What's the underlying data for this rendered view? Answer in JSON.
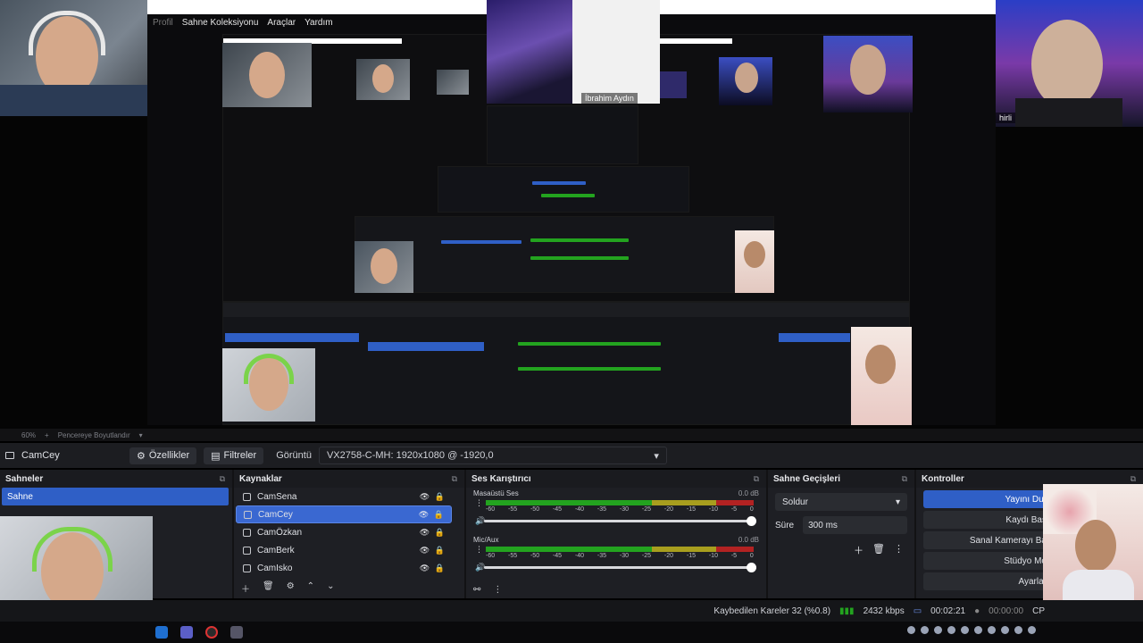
{
  "preview": {
    "menu": {
      "profile": "Profil",
      "scene_collection": "Sahne Koleksiyonu",
      "tools": "Araçlar",
      "help": "Yardım"
    },
    "cam_overlay_label": "İbrahim Aydın",
    "cam_topright_label": "hirli",
    "inner_zoom": "60%",
    "inner_fit": "Pencereye Boyutlandır"
  },
  "zoom_bar": {
    "zoom": "60%",
    "plus": "+",
    "fit_label": "Pencereye Boyutlandır"
  },
  "source_bar": {
    "current_source": "CamCey",
    "properties_label": "Özellikler",
    "filters_label": "Filtreler",
    "display_label": "Görüntü",
    "display_value": "VX2758-C-MH: 1920x1080 @ -1920,0"
  },
  "scenes": {
    "title": "Sahneler",
    "items": [
      {
        "label": "Sahne",
        "selected": true
      }
    ]
  },
  "sources": {
    "title": "Kaynaklar",
    "items": [
      {
        "label": "CamSena",
        "selected": false
      },
      {
        "label": "CamCey",
        "selected": true
      },
      {
        "label": "CamÖzkan",
        "selected": false
      },
      {
        "label": "CamBerk",
        "selected": false
      },
      {
        "label": "CamIsko",
        "selected": false
      }
    ]
  },
  "mixer": {
    "title": "Ses Karıştırıcı",
    "tracks": [
      {
        "name": "Masaüstü Ses",
        "db": "0.0 dB",
        "level": 0.6
      },
      {
        "name": "Mic/Aux",
        "db": "0.0 dB",
        "level": 0.45
      }
    ],
    "scale": [
      "-60",
      "-55",
      "-50",
      "-45",
      "-40",
      "-35",
      "-30",
      "-25",
      "-20",
      "-15",
      "-10",
      "-5",
      "0"
    ]
  },
  "transitions": {
    "title": "Sahne Geçişleri",
    "selected": "Soldur",
    "duration_label": "Süre",
    "duration_value": "300 ms"
  },
  "controls": {
    "title": "Kontroller",
    "buttons": [
      "Yayını Dur",
      "Kaydı Baş",
      "Sanal Kamerayı Ba",
      "Stüdyo Mo",
      "Ayarlar"
    ]
  },
  "status": {
    "dropped": "Kaybedilen Kareler 32 (%0.8)",
    "bitrate": "2432 kbps",
    "stream_time": "00:02:21",
    "rec_time": "00:00:00",
    "cpu": "CP"
  },
  "colors": {
    "accent": "#2f5fc6",
    "meter_green": "#23a31f",
    "meter_yellow": "#a89e1e",
    "meter_red": "#b22222"
  }
}
